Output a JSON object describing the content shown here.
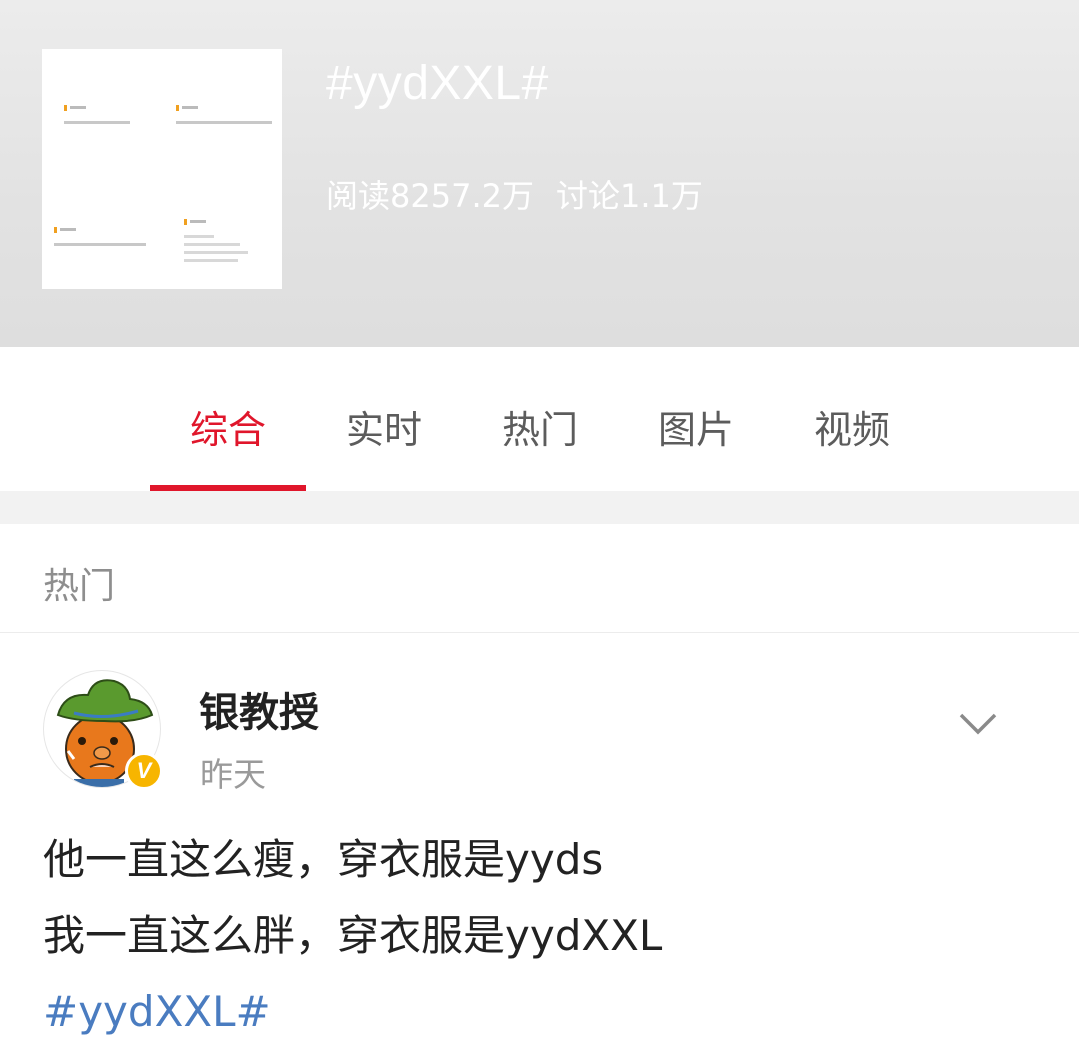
{
  "topic": {
    "title": "#yydXXL#",
    "reads": "阅读8257.2万",
    "discussions": "讨论1.1万"
  },
  "tabs": [
    {
      "label": "综合",
      "active": true
    },
    {
      "label": "实时",
      "active": false
    },
    {
      "label": "热门",
      "active": false
    },
    {
      "label": "图片",
      "active": false
    },
    {
      "label": "视频",
      "active": false
    }
  ],
  "section": {
    "title": "热门"
  },
  "post": {
    "username": "银教授",
    "time": "昨天",
    "verified_badge": "V",
    "lines": [
      "他一直这么瘦，穿衣服是yyds",
      "我一直这么胖，穿衣服是yydXXL"
    ],
    "hashtag": "#yydXXL#"
  },
  "colors": {
    "accent": "#e0162b",
    "link": "#4a7cc0",
    "badge": "#f7b500"
  }
}
